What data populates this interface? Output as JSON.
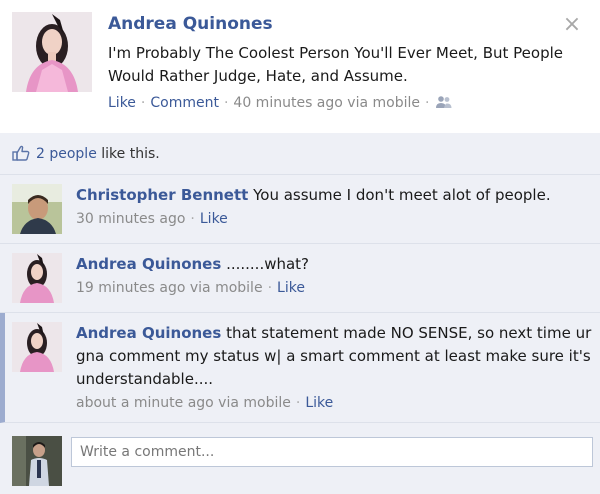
{
  "post": {
    "author": "Andrea Quinones",
    "text": "I'm Probably The Coolest Person You'll Ever Meet, But People Would Rather Judge, Hate, and Assume.",
    "like_label": "Like",
    "comment_label": "Comment",
    "timestamp": "40 minutes ago via mobile",
    "close_glyph": "×",
    "audience_icon": "friends-icon"
  },
  "likes": {
    "count_label": "2 people",
    "suffix": " like this.",
    "icon": "thumbs-up-icon"
  },
  "comments": [
    {
      "author": "Christopher Bennett",
      "text": "You assume I don't meet alot of people.",
      "timestamp": "30 minutes ago",
      "like_label": "Like"
    },
    {
      "author": "Andrea Quinones",
      "text": "........what?",
      "timestamp": "19 minutes ago via mobile",
      "like_label": "Like"
    },
    {
      "author": "Andrea Quinones",
      "text": "that statement made NO SENSE, so next time ur gna comment my status w| a smart comment at least make sure it's understandable....",
      "timestamp": "about a minute ago via mobile",
      "like_label": "Like"
    }
  ],
  "composer": {
    "placeholder": "Write a comment..."
  },
  "colors": {
    "link": "#3b5998",
    "ufi_background": "#eef0f6",
    "highlight_bar": "#9daccf"
  }
}
